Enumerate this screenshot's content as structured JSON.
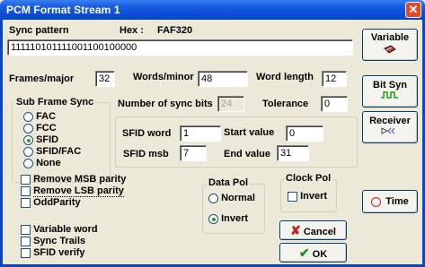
{
  "window": {
    "title": "PCM Format Stream 1",
    "close_glyph": "✕"
  },
  "sync": {
    "label": "Sync pattern",
    "hex_label": "Hex :",
    "hex_value": "FAF320",
    "pattern": "111110101111001100100000"
  },
  "frames": {
    "label": "Frames/major",
    "value": "32"
  },
  "words": {
    "label": "Words/minor",
    "value": "48"
  },
  "word_length": {
    "label": "Word length",
    "value": "12"
  },
  "subframe": {
    "title": "Sub Frame Sync",
    "options": [
      "FAC",
      "FCC",
      "SFID",
      "SFID/FAC",
      "None"
    ],
    "selected": "SFID"
  },
  "num_sync_bits": {
    "label": "Number of sync bits",
    "value": "24"
  },
  "tolerance": {
    "label": "Tolerance",
    "value": "0"
  },
  "sfid": {
    "word_label": "SFID word",
    "word_value": "1",
    "start_label": "Start value",
    "start_value": "0",
    "msb_label": "SFID msb",
    "msb_value": "7",
    "end_label": "End value",
    "end_value": "31"
  },
  "parity": [
    "Remove MSB parity",
    "Remove LSB parity",
    "OddParity"
  ],
  "extras": [
    "Variable word",
    "Sync Trails",
    "SFID verify"
  ],
  "data_pol": {
    "title": "Data Pol",
    "options": [
      "Normal",
      "Invert"
    ],
    "selected": "Invert"
  },
  "clock_pol": {
    "title": "Clock Pol",
    "invert_label": "Invert"
  },
  "buttons": {
    "variable": "Variable",
    "bit_syn": "Bit Syn",
    "receiver": "Receiver",
    "time": "Time",
    "cancel": "Cancel",
    "ok": "OK"
  },
  "colors": {
    "titlebar": "#0a4fd6",
    "dialog_bg": "#ece9d8",
    "ok_check": "#1f8f1f",
    "cancel_x": "#c8201b",
    "bitsyn_wave": "#1f9f1f"
  },
  "icons": {
    "variable": "notepad-pencil-icon",
    "bit_syn": "square-wave-icon",
    "receiver": "signal-receiver-icon",
    "time": "clock-icon",
    "cancel": "x-icon",
    "ok": "check-icon"
  }
}
